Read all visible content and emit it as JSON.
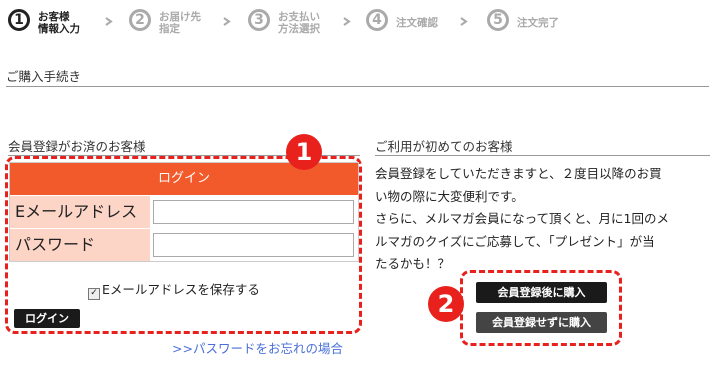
{
  "steps": [
    {
      "num": "1",
      "line1": "お客様",
      "line2": "情報入力",
      "active": true
    },
    {
      "num": "2",
      "line1": "お届け先",
      "line2": "指定",
      "active": false
    },
    {
      "num": "3",
      "line1": "お支払い",
      "line2": "方法選択",
      "active": false
    },
    {
      "num": "4",
      "line1": "注文確認",
      "line2": "",
      "active": false
    },
    {
      "num": "5",
      "line1": "注文完了",
      "line2": "",
      "active": false
    }
  ],
  "page_title": "ご購入手続き",
  "member": {
    "title": "会員登録がお済のお客様",
    "login_header": "ログイン",
    "email_label": "Eメールアドレス",
    "email_value": "",
    "password_label": "パスワード",
    "password_value": "",
    "remember_label": "Eメールアドレスを保存する",
    "remember_checked": true,
    "login_button": "ログイン",
    "forgot_link": ">>パスワードをお忘れの場合"
  },
  "guest": {
    "title": "ご利用が初めてのお客様",
    "line1": "会員登録をしていただきますと、２度目以降のお買",
    "line2": "い物の際に大変便利です。",
    "line3": "さらに、メルマガ会員になって頂くと、月に1回のメ",
    "line4": "ルマガのクイズにご応募して、「プレゼント」が当",
    "line5": "たるかも！？",
    "buy_after_register": "会員登録後に購入",
    "buy_without_register": "会員登録せずに購入"
  },
  "badges": {
    "one": "1",
    "two": "2"
  },
  "colors": {
    "accent": "#f25a2b",
    "annotation": "#e8211c",
    "label_bg": "#fcd5c7",
    "link": "#4a6fd8"
  }
}
